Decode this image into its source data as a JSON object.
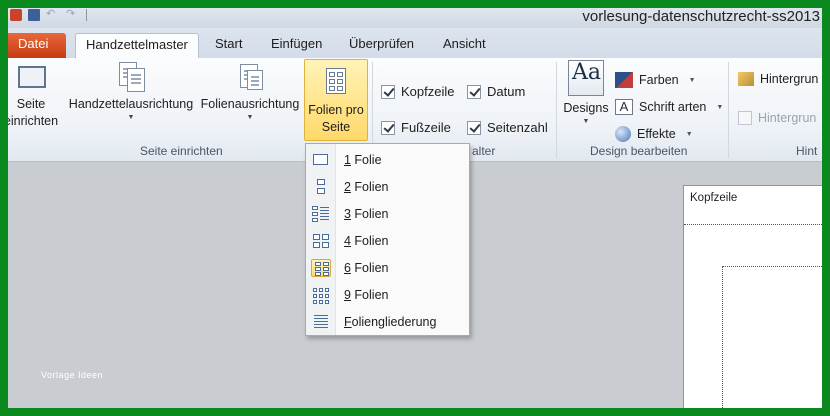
{
  "window": {
    "document_title": "vorlesung-datenschutzrecht-ss2013"
  },
  "tabs": [
    {
      "label": "Datei"
    },
    {
      "label": "Handzettelmaster"
    },
    {
      "label": "Start"
    },
    {
      "label": "Einfügen"
    },
    {
      "label": "Überprüfen"
    },
    {
      "label": "Ansicht"
    }
  ],
  "ribbon": {
    "seite_einrichten": {
      "group_label": "Seite einrichten",
      "setup_label_1": "Seite",
      "setup_label_2": "einrichten",
      "handout_orientation": "Handzettelausrichtung",
      "slide_orientation": "Folienausrichtung",
      "slides_per_page_1": "Folien pro",
      "slides_per_page_2": "Seite"
    },
    "platzhalter": {
      "group_label": "alter",
      "kopfzeile": "Kopfzeile",
      "datum": "Datum",
      "fusszeile": "Fußzeile",
      "seitenzahl": "Seitenzahl"
    },
    "design": {
      "group_label": "Design bearbeiten",
      "designs_label": "Designs",
      "designs_glyph": "Aa",
      "farben": "Farben",
      "schriftarten": "Schrift arten",
      "effekte": "Effekte",
      "font_glyph": "A"
    },
    "hintergrund": {
      "group_label": "Hint",
      "styles": "Hintergrun",
      "hide": "Hintergrun"
    }
  },
  "menu": {
    "items": [
      {
        "label": "1 Folie"
      },
      {
        "label": "2 Folien"
      },
      {
        "label": "3 Folien"
      },
      {
        "label": "4 Folien"
      },
      {
        "label": "6 Folien"
      },
      {
        "label": "9 Folien"
      },
      {
        "label": "Foliengliederung"
      }
    ]
  },
  "canvas": {
    "header_placeholder": "Kopfzeile",
    "watermark": "Vorlage Ideen"
  },
  "colors": {
    "accent": "#f2c44a",
    "file_tab": "#d54d1f",
    "frame_border": "#0a8a1e"
  }
}
